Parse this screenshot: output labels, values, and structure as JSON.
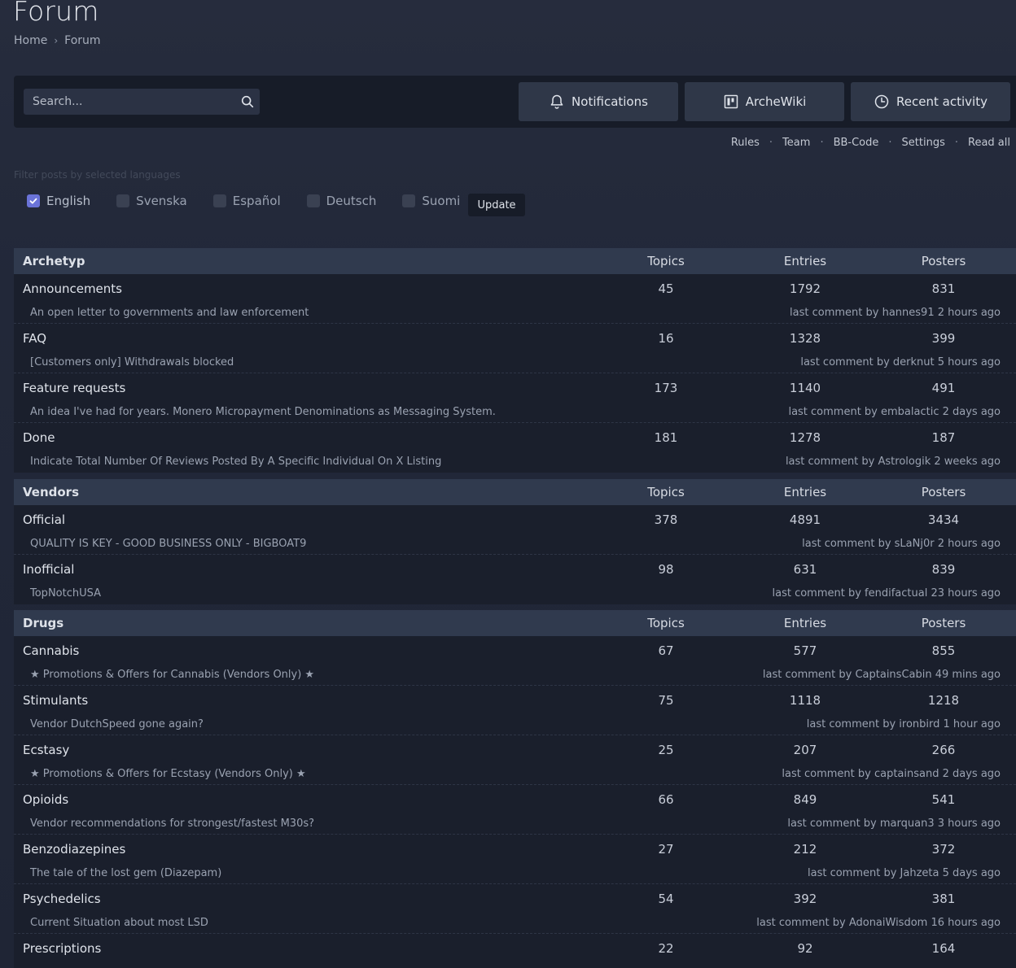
{
  "page": {
    "title": "Forum"
  },
  "breadcrumb": {
    "home": "Home",
    "current": "Forum"
  },
  "toolbar": {
    "search_placeholder": "Search...",
    "notifications": "Notifications",
    "wiki": "ArcheWiki",
    "recent": "Recent activity"
  },
  "links": [
    "Rules",
    "Team",
    "BB-Code",
    "Settings",
    "Read all"
  ],
  "filter": {
    "label": "Filter posts by selected languages",
    "languages": [
      {
        "name": "English",
        "checked": true
      },
      {
        "name": "Svenska",
        "checked": false
      },
      {
        "name": "Español",
        "checked": false
      },
      {
        "name": "Deutsch",
        "checked": false
      },
      {
        "name": "Suomi",
        "checked": false
      }
    ],
    "update": "Update"
  },
  "columns": {
    "topics": "Topics",
    "entries": "Entries",
    "posters": "Posters"
  },
  "sections": [
    {
      "name": "Archetyp",
      "forums": [
        {
          "title": "Announcements",
          "topics": "45",
          "entries": "1792",
          "posters": "831",
          "sub": "An open letter to governments and law enforcement",
          "last": "last comment by hannes91 2 hours ago"
        },
        {
          "title": "FAQ",
          "topics": "16",
          "entries": "1328",
          "posters": "399",
          "sub": "[Customers only] Withdrawals blocked",
          "last": "last comment by derknut 5 hours ago"
        },
        {
          "title": "Feature requests",
          "topics": "173",
          "entries": "1140",
          "posters": "491",
          "sub": "An idea I've had for years. Monero Micropayment Denominations as Messaging System.",
          "last": "last comment by embalactic 2 days ago"
        },
        {
          "title": "Done",
          "topics": "181",
          "entries": "1278",
          "posters": "187",
          "sub": "Indicate Total Number Of Reviews Posted By A Specific Individual On X Listing",
          "last": "last comment by Astrologik 2 weeks ago"
        }
      ]
    },
    {
      "name": "Vendors",
      "forums": [
        {
          "title": "Official",
          "topics": "378",
          "entries": "4891",
          "posters": "3434",
          "sub": "QUALITY IS KEY - GOOD BUSINESS ONLY - BIGBOAT9",
          "last": "last comment by sLaNj0r 2 hours ago"
        },
        {
          "title": "Inofficial",
          "topics": "98",
          "entries": "631",
          "posters": "839",
          "sub": "TopNotchUSA",
          "last": "last comment by fendifactual 23 hours ago"
        }
      ]
    },
    {
      "name": "Drugs",
      "forums": [
        {
          "title": "Cannabis",
          "topics": "67",
          "entries": "577",
          "posters": "855",
          "sub": "★ Promotions & Offers for Cannabis (Vendors Only) ★",
          "last": "last comment by CaptainsCabin 49 mins ago"
        },
        {
          "title": "Stimulants",
          "topics": "75",
          "entries": "1118",
          "posters": "1218",
          "sub": "Vendor DutchSpeed gone again?",
          "last": "last comment by ironbird 1 hour ago"
        },
        {
          "title": "Ecstasy",
          "topics": "25",
          "entries": "207",
          "posters": "266",
          "sub": "★ Promotions & Offers for Ecstasy (Vendors Only) ★",
          "last": "last comment by captainsand 2 days ago"
        },
        {
          "title": "Opioids",
          "topics": "66",
          "entries": "849",
          "posters": "541",
          "sub": "Vendor recommendations for strongest/fastest M30s?",
          "last": "last comment by marquan3 3 hours ago"
        },
        {
          "title": "Benzodiazepines",
          "topics": "27",
          "entries": "212",
          "posters": "372",
          "sub": "The tale of the lost gem (Diazepam)",
          "last": "last comment by Jahzeta 5 days ago"
        },
        {
          "title": "Psychedelics",
          "topics": "54",
          "entries": "392",
          "posters": "381",
          "sub": "Current Situation about most LSD",
          "last": "last comment by AdonaiWisdom 16 hours ago"
        },
        {
          "title": "Prescriptions",
          "topics": "22",
          "entries": "92",
          "posters": "164",
          "sub": "",
          "last": ""
        }
      ]
    }
  ]
}
